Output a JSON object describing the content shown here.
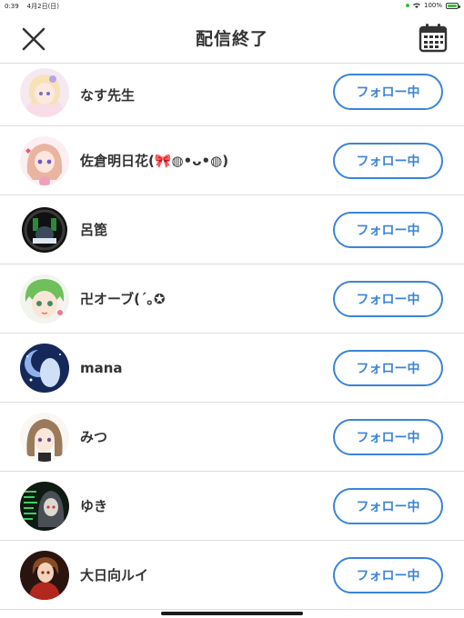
{
  "status_bar": {
    "time": "0:39",
    "date": "4月2日(日)",
    "battery": "100%",
    "battery_level": 1.0
  },
  "header": {
    "title": "配信終了",
    "close_icon": "close-icon",
    "calendar_icon": "calendar-icon"
  },
  "colors": {
    "accent": "#3a84d9",
    "divider": "#dcdcdc"
  },
  "follow_label": "フォロー中",
  "users": [
    {
      "name": "なす先生",
      "avatar": "avatar-anime-girl-pastel"
    },
    {
      "name": "佐倉明日花(🎀◍•ᴗ•◍)",
      "avatar": "avatar-anime-girl-pink"
    },
    {
      "name": "呂箆",
      "avatar": "avatar-dark-ring"
    },
    {
      "name": "卍オーブ(´｡✪",
      "avatar": "avatar-green-hair"
    },
    {
      "name": "mana",
      "avatar": "avatar-blue-moon"
    },
    {
      "name": "みつ",
      "avatar": "avatar-brown-hair-girl"
    },
    {
      "name": "ゆき",
      "avatar": "avatar-dark-green-text"
    },
    {
      "name": "大日向ルイ",
      "avatar": "avatar-red-coat"
    }
  ]
}
